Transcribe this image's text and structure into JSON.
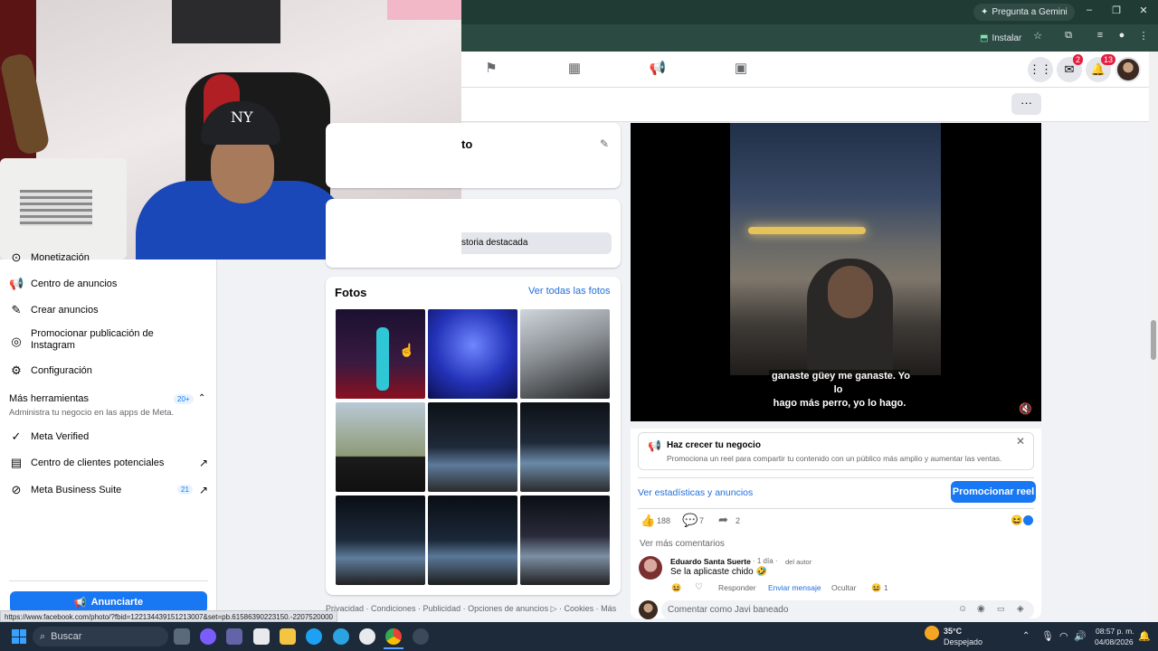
{
  "browser": {
    "gemini_label": "Pregunta a Gemini",
    "install_label": "Instalar"
  },
  "fb_nav": {
    "messenger_badge": "2",
    "notifications_badge": "13"
  },
  "sidebar": {
    "partial_item": "Monetización",
    "items": [
      {
        "label": "Centro de anuncios",
        "icon": "megaphone-icon"
      },
      {
        "label": "Crear anuncios",
        "icon": "edit-icon"
      },
      {
        "label": "Promocionar publicación de Instagram",
        "icon": "instagram-icon"
      },
      {
        "label": "Configuración",
        "icon": "gear-icon"
      }
    ],
    "more_tools": {
      "title": "Más herramientas",
      "count": "20+",
      "subtitle": "Administra tu negocio en las apps de Meta."
    },
    "tools": [
      {
        "label": "Meta Verified"
      },
      {
        "label": "Centro de clientes potenciales"
      },
      {
        "label": "Meta Business Suite",
        "count": "21"
      }
    ],
    "advertise_button": "Anunciarte"
  },
  "status_url": "https://www.facebook.com/photo/?fbid=122134439151213007&set=pb.61586390223150.-2207520000",
  "middle": {
    "intro_partial": "to",
    "featured_partial": "storia destacada",
    "photos": {
      "title": "Fotos",
      "see_all": "Ver todas las fotos"
    },
    "footer": "Privacidad · Condiciones · Publicidad · Opciones de anuncios ▷ · Cookies · Más"
  },
  "reel": {
    "caption_line1": "ganaste güey me ganaste. Yo lo",
    "caption_line2": "hago más perro, yo lo hago."
  },
  "promo": {
    "title": "Haz crecer tu negocio",
    "subtitle": "Promociona un reel para compartir tu contenido con un público más amplio y aumentar las ventas.",
    "stats_link": "Ver estadísticas y anuncios",
    "promote_button": "Promocionar reel",
    "likes": "188",
    "comments": "7",
    "shares": "2",
    "more_comments": "Ver más comentarios",
    "comment": {
      "author": "Eduardo Santa Suerte",
      "meta": "· 1 día ·",
      "author_tag": "del autor",
      "text": "Se la aplicaste chido 🤣",
      "reply": "Responder",
      "send_message": "Enviar mensaje",
      "hide": "Ocultar",
      "reaction_count": "1"
    },
    "comment_placeholder": "Comentar como Javi baneado"
  },
  "taskbar": {
    "search_label": "Buscar",
    "weather_temp": "35°C",
    "weather_desc": "Despejado",
    "time": "08:57 p. m.",
    "date": "04/08/2026"
  },
  "colors": {
    "fb_blue": "#1877f2",
    "chrome_frame": "#1f3b34",
    "taskbar": "#1c2a3a"
  }
}
